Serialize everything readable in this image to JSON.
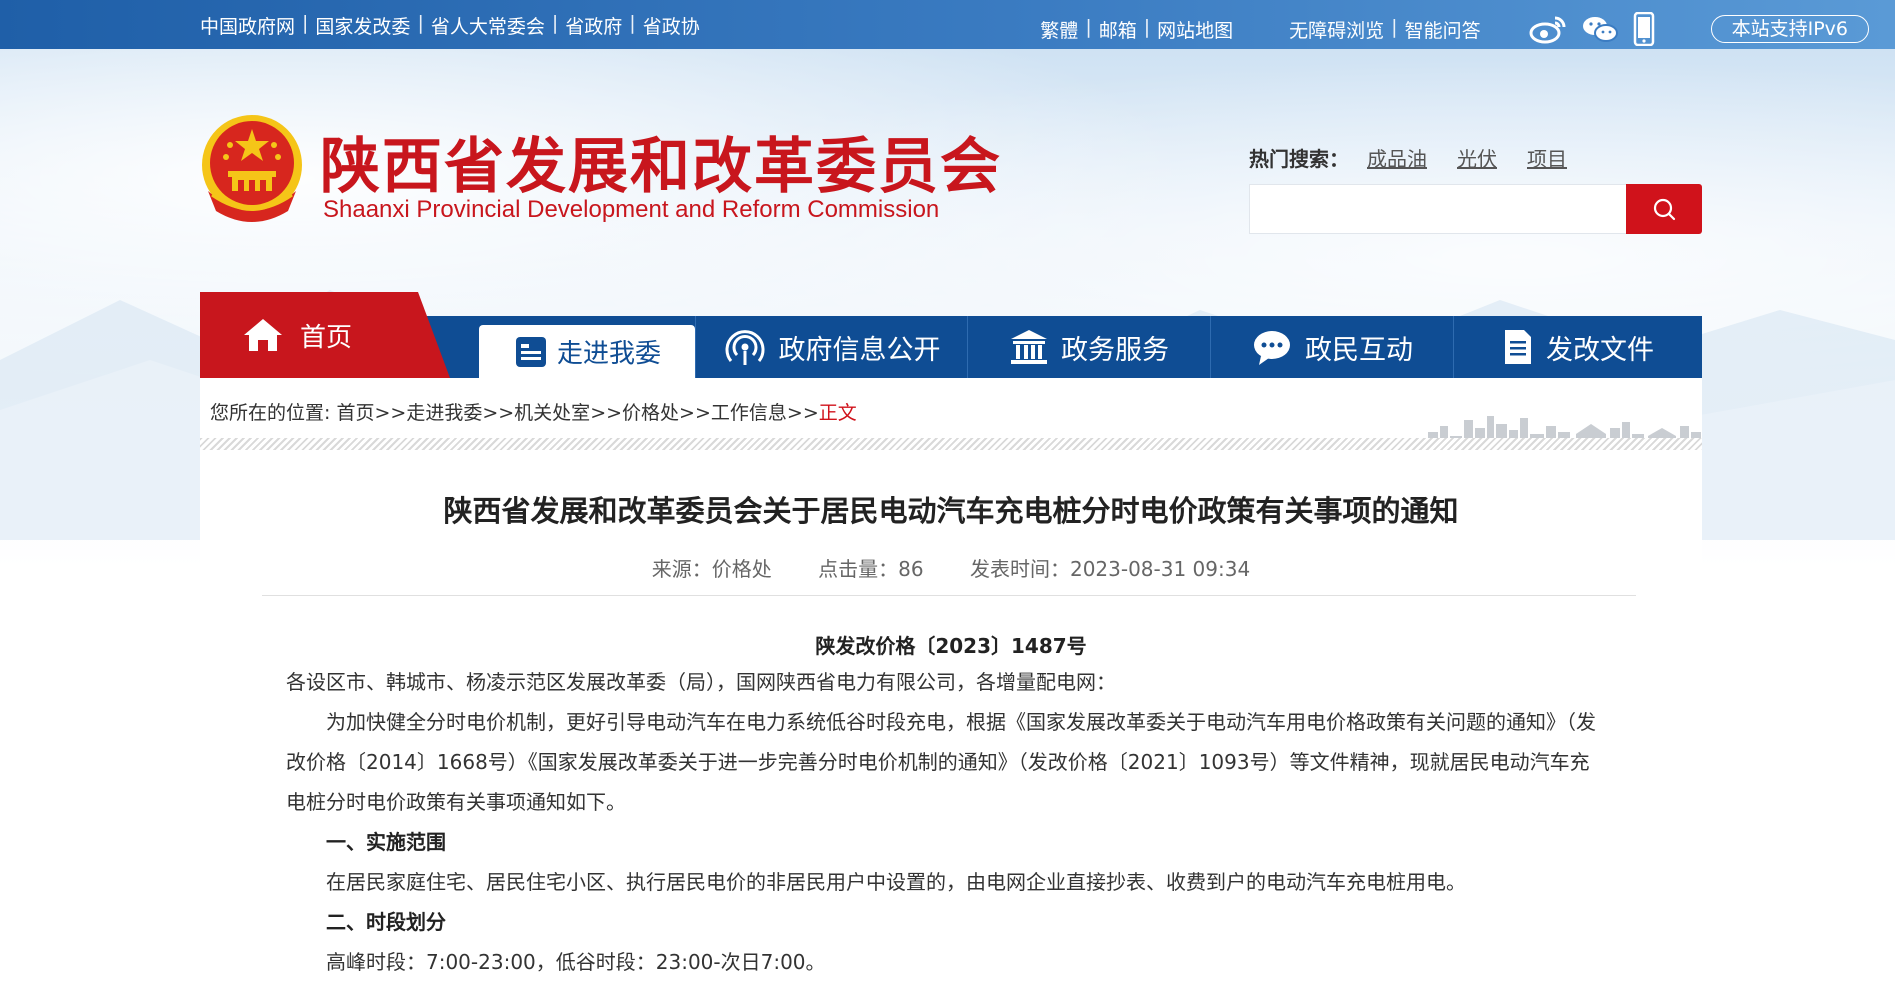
{
  "topbar": {
    "left_links": [
      "中国政府网",
      "国家发改委",
      "省人大常委会",
      "省政府",
      "省政协"
    ],
    "right_links_1": [
      "繁體",
      "邮箱",
      "网站地图"
    ],
    "right_links_2": [
      "无障碍浏览",
      "智能问答"
    ],
    "ipv6": "本站支持IPv6"
  },
  "header": {
    "title": "陕西省发展和改革委员会",
    "subtitle": "Shaanxi Provincial Development and Reform Commission",
    "hot_label": "热门搜索：",
    "hot_keywords": [
      "成品油",
      "光伏",
      "项目"
    ],
    "search_placeholder": ""
  },
  "nav": {
    "home": "首页",
    "active": "走进我委",
    "items": [
      "政府信息公开",
      "政务服务",
      "政民互动",
      "发改文件"
    ]
  },
  "breadcrumb": {
    "prefix": "您所在的位置: ",
    "items": [
      "首页",
      "走进我委",
      "机关处室",
      "价格处",
      "工作信息"
    ],
    "current": "正文",
    "separator": ">>"
  },
  "article": {
    "title": "陕西省发展和改革委员会关于居民电动汽车充电桩分时电价政策有关事项的通知",
    "source": "来源：价格处",
    "clicks": "点击量：86",
    "published": "发表时间：2023-08-31 09:34",
    "doc_no": "陕发改价格〔2023〕1487号",
    "addressee": "各设区市、韩城市、杨凌示范区发展改革委（局），国网陕西省电力有限公司，各增量配电网：",
    "p1_line1": "为加快健全分时电价机制，更好引导电动汽车在电力系统低谷时段充电，根据《国家发展改革委关于电动汽车用电价格政策有关问题的通知》（发",
    "p1_line2": "改价格〔2014〕1668号）《国家发展改革委关于进一步完善分时电价机制的通知》（发改价格〔2021〕1093号）等文件精神，现就居民电动汽车充",
    "p1_line3": "电桩分时电价政策有关事项通知如下。",
    "h1": "一、实施范围",
    "p2": "在居民家庭住宅、居民住宅小区、执行居民电价的非居民用户中设置的，由电网企业直接抄表、收费到户的电动汽车充电桩用电。",
    "h2": "二、时段划分",
    "p3": "高峰时段：7:00-23:00，低谷时段：23:00-次日7:00。"
  },
  "colors": {
    "brand_red": "#c8161d",
    "nav_blue": "#0f4d94",
    "topbar_blue": "#1f5fa8"
  }
}
